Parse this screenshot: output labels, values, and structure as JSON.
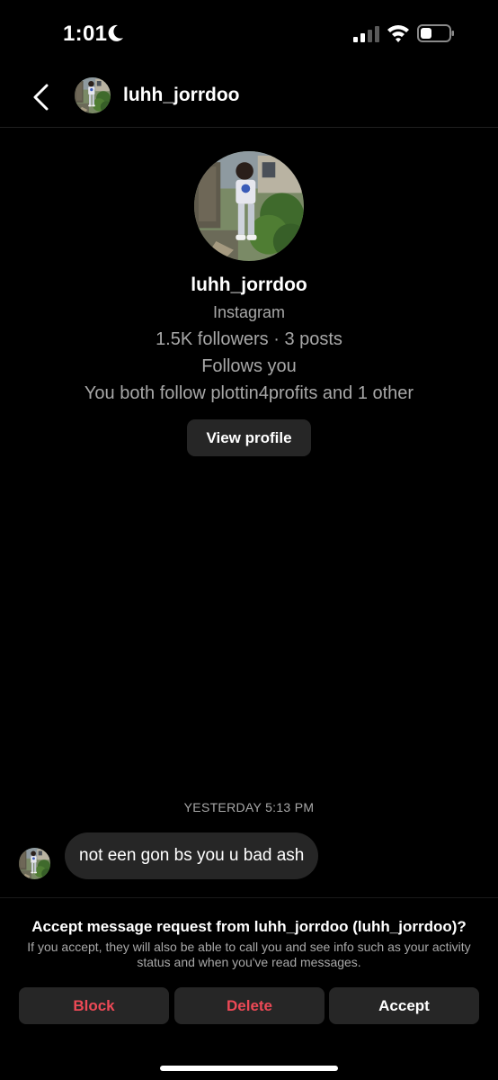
{
  "status_bar": {
    "time": "1:01",
    "icons": [
      "moon-icon",
      "cellular-signal-icon",
      "wifi-icon",
      "battery-icon"
    ]
  },
  "header": {
    "back_icon": "chevron-left-icon",
    "username": "luhh_jorrdoo"
  },
  "profile": {
    "username": "luhh_jorrdoo",
    "source": "Instagram",
    "stats": "1.5K followers · 3 posts",
    "follow_status": "Follows you",
    "mutual": "You both follow plottin4profits and 1 other",
    "view_profile_label": "View profile"
  },
  "conversation": {
    "timestamp": "YESTERDAY 5:13 PM",
    "messages": [
      {
        "sender": "luhh_jorrdoo",
        "text": "not een gon bs you u bad ash"
      }
    ]
  },
  "request": {
    "title": "Accept message request from luhh_jorrdoo (luhh_jorrdoo)?",
    "description": "If you accept, they will also be able to call you and see info such as your activity status and when you've read messages.",
    "block_label": "Block",
    "delete_label": "Delete",
    "accept_label": "Accept"
  },
  "colors": {
    "background": "#000000",
    "surface": "#262626",
    "secondary_text": "#a8a8a8",
    "destructive": "#ed4956"
  }
}
